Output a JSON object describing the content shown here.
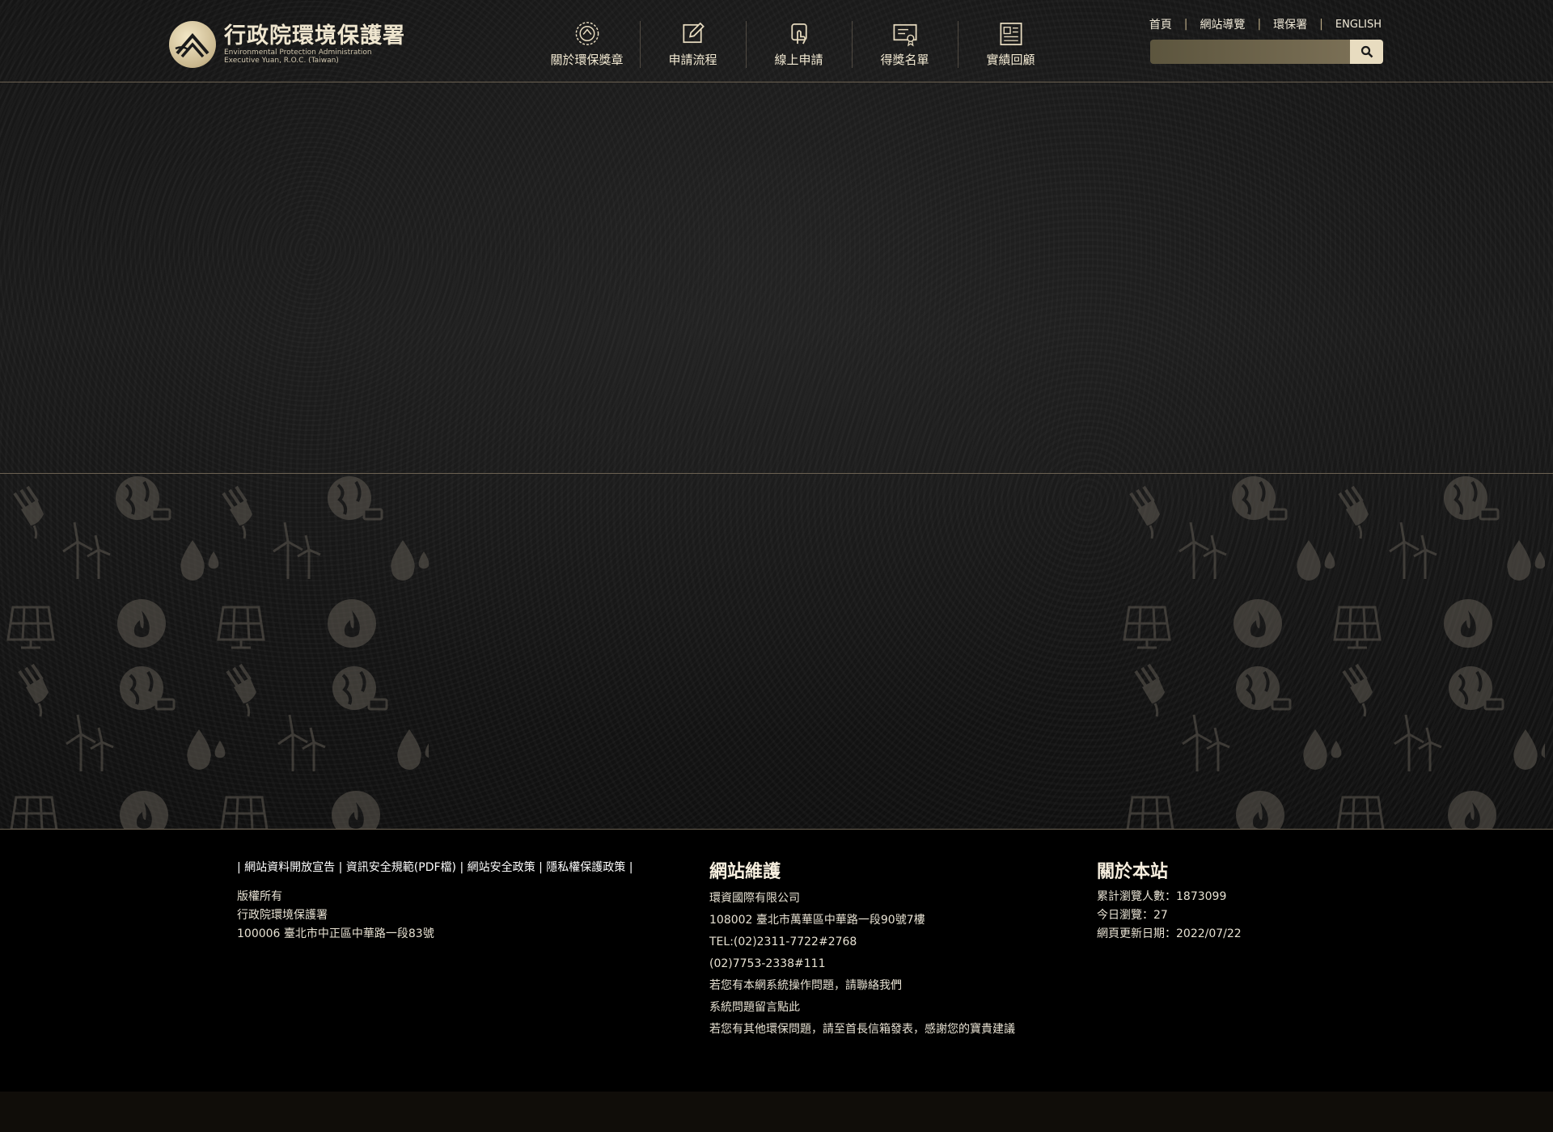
{
  "logo": {
    "title": "行政院環境保護署",
    "subtitle_line1": "Environmental Protection Administration",
    "subtitle_line2": "Executive Yuan, R.O.C. (Taiwan)"
  },
  "nav": {
    "items": [
      {
        "label": "關於環保獎章",
        "icon": "badge-icon"
      },
      {
        "label": "申請流程",
        "icon": "edit-icon"
      },
      {
        "label": "線上申請",
        "icon": "apply-online-icon"
      },
      {
        "label": "得獎名單",
        "icon": "certificate-icon"
      },
      {
        "label": "實績回顧",
        "icon": "document-icon"
      }
    ]
  },
  "utility": {
    "home": "首頁",
    "sitemap": "網站導覽",
    "epa": "環保署",
    "english": "ENGLISH"
  },
  "search": {
    "placeholder": "",
    "value": "",
    "icon": "search-icon"
  },
  "footer": {
    "links": [
      "網站資料開放宣告",
      "資訊安全規範(PDF檔)",
      "網站安全政策",
      "隱私權保護政策"
    ],
    "copyright": {
      "label": "版權所有",
      "org": "行政院環境保護署",
      "address": "100006 臺北市中正區中華路一段83號"
    },
    "maintenance": {
      "heading": "網站維護",
      "company": "環資國際有限公司",
      "address": "108002 臺北市萬華區中華路一段90號7樓",
      "tel1": "TEL:(02)2311-7722#2768",
      "tel2": "(02)7753-2338#111",
      "contact_note": "若您有本網系統操作問題，請聯絡我們",
      "message_link": "系統問題留言點此",
      "other_note": "若您有其他環保問題，請至首長信箱發表，感謝您的寶貴建議"
    },
    "about": {
      "heading": "關於本站",
      "total_visits": "累計瀏覽人數：1873099",
      "today_visits": "今日瀏覽：27",
      "updated": "網頁更新日期：2022/07/22"
    }
  },
  "colors": {
    "accent_gold": "#e8dcc0",
    "divider": "#6b6152",
    "footer_bg": "#000000"
  }
}
